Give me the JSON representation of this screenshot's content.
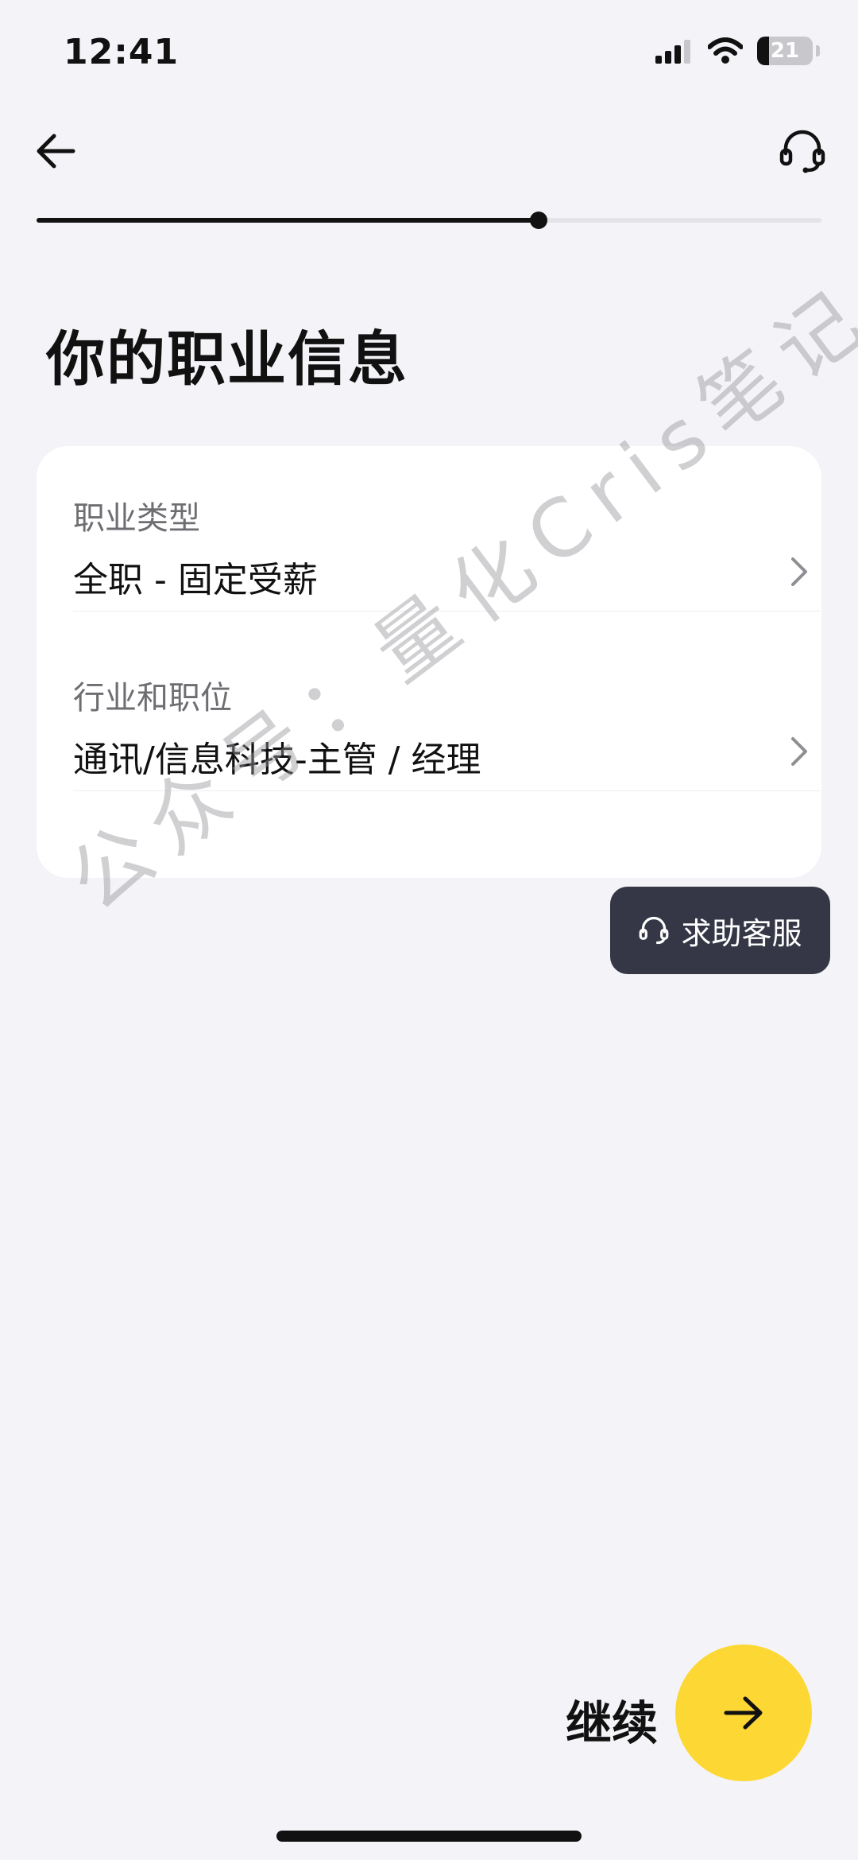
{
  "status_bar": {
    "time": "12:41",
    "battery_level": "21",
    "icons": [
      "signal-icon",
      "wifi-icon",
      "battery-icon"
    ]
  },
  "nav": {
    "back_icon": "arrow-left-icon",
    "support_icon": "headset-icon"
  },
  "progress": {
    "fraction": 0.64
  },
  "page": {
    "title": "你的职业信息"
  },
  "fields": [
    {
      "label": "职业类型",
      "value": "全职 - 固定受薪",
      "icon": "chevron-right-icon"
    },
    {
      "label": "行业和职位",
      "value": "通讯/信息科技-主管 / 经理",
      "icon": "chevron-right-icon"
    }
  ],
  "help": {
    "label": "求助客服",
    "icon": "headset-icon"
  },
  "watermark": {
    "text": "公众号：量化Cris笔记"
  },
  "footer": {
    "continue_label": "继续",
    "continue_icon": "arrow-right-icon"
  },
  "colors": {
    "background": "#f4f4f8",
    "accent": "#fdd733",
    "dark": "#111111",
    "help_bg": "#353746"
  }
}
